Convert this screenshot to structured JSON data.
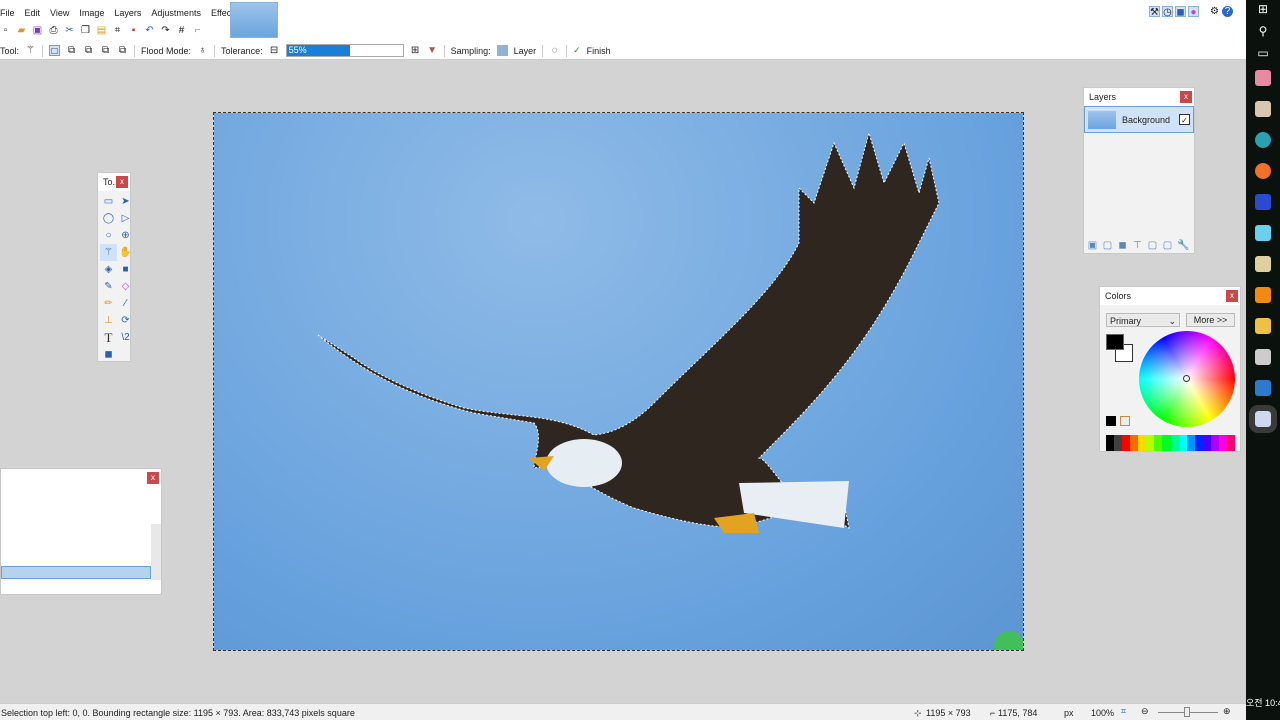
{
  "menu": [
    "File",
    "Edit",
    "View",
    "Image",
    "Layers",
    "Adjustments",
    "Effects"
  ],
  "options": {
    "tool_label": "Tool:",
    "flood_mode_label": "Flood Mode:",
    "tolerance_label": "Tolerance:",
    "tolerance_value": "55%",
    "tolerance_percent": 55,
    "sampling_label": "Sampling:",
    "sampling_value": "Layer",
    "finish_label": "Finish"
  },
  "tools_window": {
    "title": "To..."
  },
  "layers": {
    "title": "Layers",
    "items": [
      {
        "name": "Background",
        "visible": true
      }
    ]
  },
  "colors": {
    "title": "Colors",
    "mode": "Primary",
    "more": "More >>",
    "primary": "#000000",
    "secondary": "#ffffff"
  },
  "palette": [
    "#000000",
    "#404040",
    "#ff0000",
    "#ff6a00",
    "#ffd800",
    "#b6ff00",
    "#4cff00",
    "#00ff21",
    "#00ff90",
    "#00ffff",
    "#0094ff",
    "#0026ff",
    "#4800ff",
    "#b200ff",
    "#ff00dc",
    "#ff006e"
  ],
  "status": {
    "selection": "Selection top left: 0, 0. Bounding rectangle size: 1195 × 793. Area: 833,743 pixels square",
    "size": "1195 × 793",
    "cursor": "1175, 784",
    "units": "px",
    "zoom": "100%"
  },
  "taskbar": {
    "clock": "오전 10:4"
  }
}
